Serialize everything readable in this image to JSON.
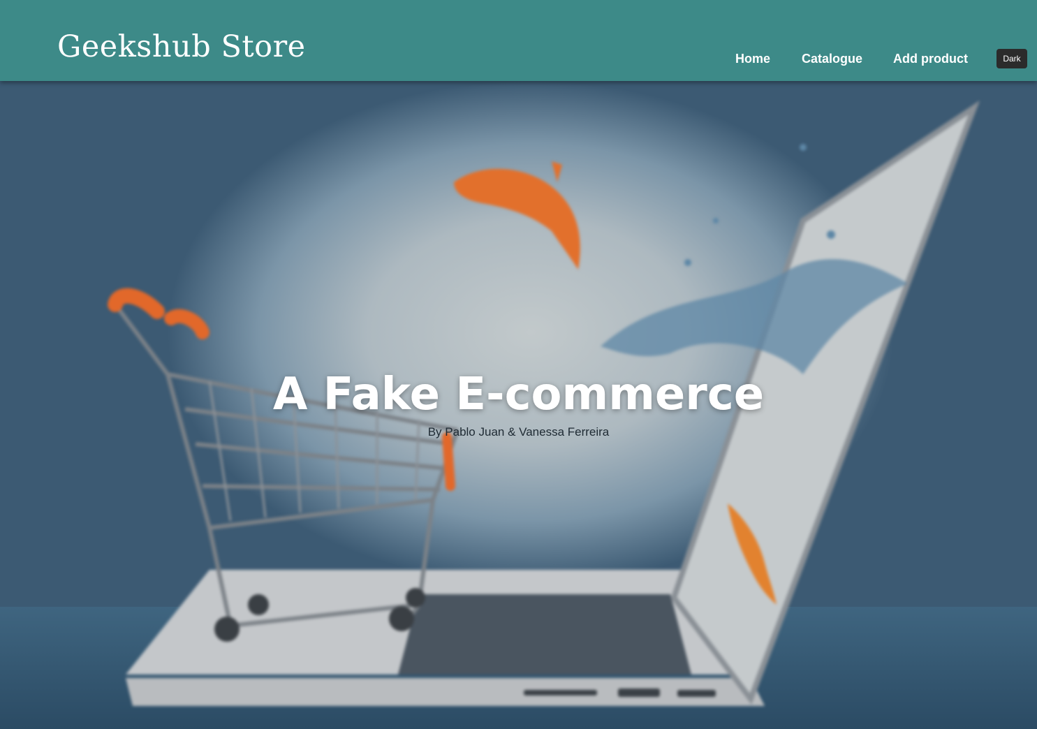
{
  "header": {
    "brand": "Geekshub Store",
    "nav": [
      {
        "label": "Home"
      },
      {
        "label": "Catalogue"
      },
      {
        "label": "Add product"
      }
    ],
    "theme_toggle_label": "Dark"
  },
  "hero": {
    "title": "A Fake E-commerce",
    "subtitle": "By Pablo Juan & Vanessa Ferreira",
    "image_subject": "shopping cart on a laptop with goldfish jumping out of the screen"
  },
  "colors": {
    "header_bg": "#3d8a88",
    "header_text": "#ffffff",
    "theme_button_bg": "#2b2b2b"
  }
}
